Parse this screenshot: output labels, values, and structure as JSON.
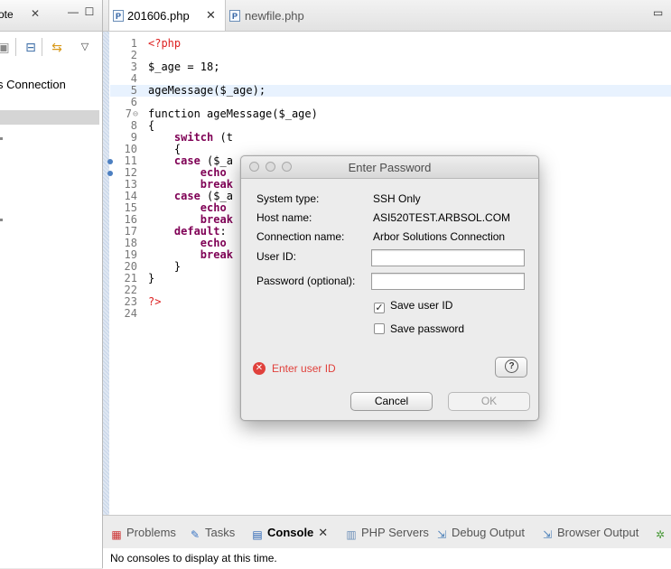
{
  "left_view": {
    "tab_title": "ote",
    "tab_close": "✕",
    "minimize": "—",
    "maximize": "☐",
    "tree_item": "s Connection"
  },
  "editor": {
    "tabs": [
      {
        "label": "201606.php",
        "close": "✕",
        "icon": "P"
      },
      {
        "label": "newfile.php",
        "icon": "P"
      }
    ],
    "minimize": "▭",
    "lines": [
      {
        "n": "1",
        "text": "<?php"
      },
      {
        "n": "2",
        "text": ""
      },
      {
        "n": "3",
        "text": "$_age = 18;"
      },
      {
        "n": "4",
        "text": ""
      },
      {
        "n": "5",
        "text": "ageMessage($_age);"
      },
      {
        "n": "6",
        "text": ""
      },
      {
        "n": "7",
        "text": "function ageMessage($_age)"
      },
      {
        "n": "8",
        "text": "{"
      },
      {
        "n": "9",
        "text": "    switch (t"
      },
      {
        "n": "10",
        "text": "    {"
      },
      {
        "n": "11",
        "text": "    case ($_a"
      },
      {
        "n": "12",
        "text": "        echo"
      },
      {
        "n": "13",
        "text": "        break"
      },
      {
        "n": "14",
        "text": "    case ($_a"
      },
      {
        "n": "15",
        "text": "        echo"
      },
      {
        "n": "16",
        "text": "        break"
      },
      {
        "n": "17",
        "text": "    default:"
      },
      {
        "n": "18",
        "text": "        echo"
      },
      {
        "n": "19",
        "text": "        break"
      },
      {
        "n": "20",
        "text": "    }"
      },
      {
        "n": "21",
        "text": "}"
      },
      {
        "n": "22",
        "text": ""
      },
      {
        "n": "23",
        "text": "?>"
      },
      {
        "n": "24",
        "text": ""
      }
    ]
  },
  "bottom": {
    "tabs": [
      {
        "label": "Problems",
        "icon": "problems-icon"
      },
      {
        "label": "Tasks",
        "icon": "tasks-icon"
      },
      {
        "label": "Console",
        "icon": "console-icon",
        "close": "✕"
      },
      {
        "label": "PHP Servers",
        "icon": "servers-icon"
      },
      {
        "label": "Debug Output",
        "icon": "debug-output-icon"
      },
      {
        "label": "Browser Output",
        "icon": "browser-output-icon"
      }
    ],
    "console_message": "No consoles to display at this time."
  },
  "dialog": {
    "title": "Enter Password",
    "system_type_label": "System type:",
    "system_type_value": "SSH Only",
    "host_name_label": "Host name:",
    "host_name_value": "ASI520TEST.ARBSOL.COM",
    "connection_name_label": "Connection name:",
    "connection_name_value": "Arbor Solutions Connection",
    "user_id_label": "User ID:",
    "user_id_value": "",
    "password_label": "Password (optional):",
    "password_value": "",
    "save_user_id_label": "Save user ID",
    "save_user_id_checked": true,
    "save_password_label": "Save password",
    "save_password_checked": false,
    "error_message": "Enter user ID",
    "help_symbol": "?",
    "cancel_label": "Cancel",
    "ok_label": "OK"
  },
  "colors": {
    "error": "#e0413c",
    "keyword": "#7f0055",
    "php_tag": "#dd2222",
    "line_highlight": "#e8f2fe",
    "selection": "#d5d5d5"
  }
}
